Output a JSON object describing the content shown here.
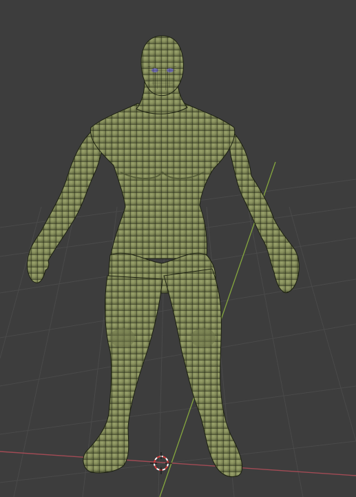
{
  "viewport": {
    "mode": "3d-viewport",
    "shading": "solid-wireframe-overlay",
    "object": "humanoid-base-mesh",
    "pose": "a-pose",
    "background_color": "#3d3d3d",
    "grid_color": "#4b4b4b",
    "x_axis_color": "#a34b55",
    "y_axis_color": "#86a83e",
    "mesh_fill_color": "#828a5a",
    "mesh_wire_color": "#1b1f10",
    "eye_color": "#6e6ab0",
    "cursor_icon": "3d-cursor-icon"
  }
}
